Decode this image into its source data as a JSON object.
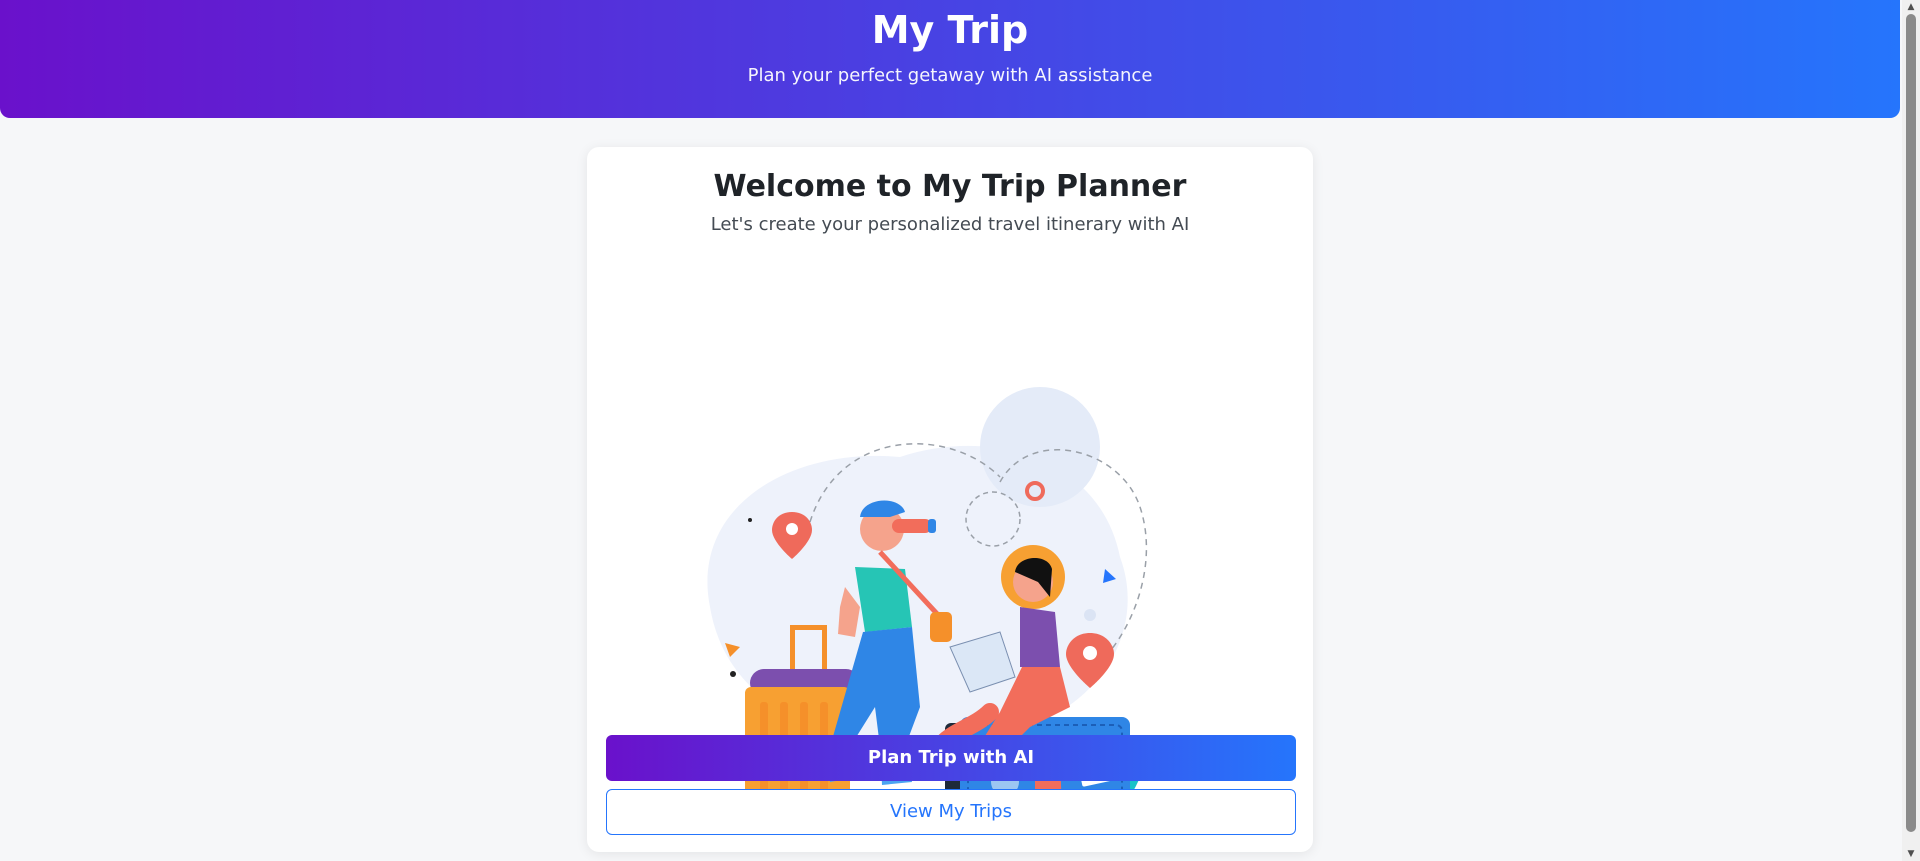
{
  "header": {
    "title": "My Trip",
    "subtitle": "Plan your perfect getaway with AI assistance"
  },
  "welcome": {
    "title": "Welcome to My Trip Planner",
    "subtitle": "Let's create your personalized travel itinerary with AI"
  },
  "actions": {
    "plan_label": "Plan Trip with AI",
    "view_label": "View My Trips"
  },
  "illustration": {
    "icon": "travelers-illustration"
  },
  "colors": {
    "gradient_start": "#6a11cb",
    "gradient_end": "#2575fc",
    "background": "#f6f7f9"
  }
}
